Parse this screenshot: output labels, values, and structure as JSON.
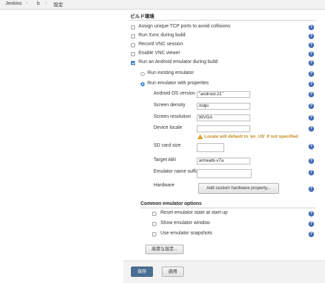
{
  "breadcrumb": {
    "items": [
      "Jenkins",
      "b",
      "設定"
    ],
    "separator": "›"
  },
  "build_env": {
    "title": "ビルド環境",
    "options": [
      {
        "label": "Assign unique TCP ports to avoid collisions",
        "checked": false
      },
      {
        "label": "Run Xvnc during build",
        "checked": false
      },
      {
        "label": "Record VNC session",
        "checked": false
      },
      {
        "label": "Enable VNC viewer",
        "checked": false
      },
      {
        "label": "Run an Android emulator during build",
        "checked": true
      }
    ],
    "radio_existing": "Run existing emulator",
    "radio_properties": "Run emulator with properties"
  },
  "props": {
    "android_os_label": "Android OS version",
    "android_os_value": "\"android-21\"",
    "density_label": "Screen density",
    "density_value": "mdpi",
    "resolution_label": "Screen resolution",
    "resolution_value": "WVGA",
    "locale_label": "Device locale",
    "locale_value": "",
    "locale_warning": "Locale will default to 'en_US' if not specified",
    "sdcard_label": "SD card size",
    "sdcard_value": "",
    "abi_label": "Target ABI",
    "abi_value": "armeabi-v7a",
    "suffix_label": "Emulator name suffix",
    "suffix_value": "",
    "hardware_label": "Hardware",
    "hardware_button": "Add custom hardware property..."
  },
  "common": {
    "title": "Common emulator options",
    "options": [
      {
        "label": "Reset emulator state at start-up",
        "checked": false
      },
      {
        "label": "Show emulator window",
        "checked": false
      },
      {
        "label": "Use emulator snapshots",
        "checked": false
      }
    ],
    "advanced_button": "高度な設定..."
  },
  "footer": {
    "save": "保存",
    "apply": "適用"
  },
  "help_glyph": "?",
  "colors": {
    "accent": "#3b86d4",
    "help": "#3f6cb5",
    "save_button": "#4a6f94",
    "warning": "#c28a1c"
  }
}
